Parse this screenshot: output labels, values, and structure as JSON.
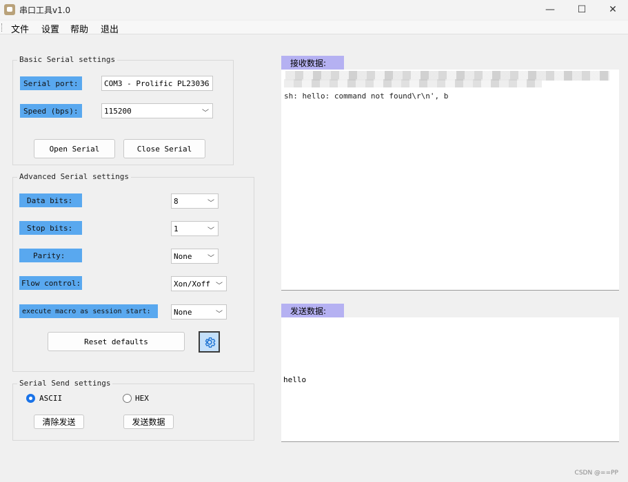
{
  "window": {
    "title": "串口工具v1.0",
    "minimize": "—",
    "maximize": "☐",
    "close": "✕"
  },
  "menu": [
    "文件",
    "设置",
    "帮助",
    "退出"
  ],
  "basic": {
    "group_title": "Basic Serial settings",
    "port_label": "Serial port:",
    "port_value": "COM3 - Prolific PL2303G",
    "speed_label": "Speed (bps):",
    "speed_value": "115200",
    "open_button": "Open Serial",
    "close_button": "Close Serial"
  },
  "advanced": {
    "group_title": "Advanced Serial settings",
    "data_bits_label": "Data bits:",
    "data_bits_value": "8",
    "stop_bits_label": "Stop bits:",
    "stop_bits_value": "1",
    "parity_label": "Parity:",
    "parity_value": "None",
    "flow_label": "Flow control:",
    "flow_value": "Xon/Xoff",
    "macro_label": "execute macro as session start:",
    "macro_value": "None",
    "reset_button": "Reset defaults"
  },
  "send_settings": {
    "group_title": "Serial Send settings",
    "ascii_label": "ASCII",
    "hex_label": "HEX",
    "ascii_selected": true,
    "clear_button": "清除发送",
    "send_button": "发送数据"
  },
  "receive": {
    "label": "接收数据:",
    "line2": "sh: hello: command not found\\r\\n', b"
  },
  "send": {
    "label": "发送数据:",
    "text": "hello"
  },
  "watermark": "CSDN @==PP"
}
